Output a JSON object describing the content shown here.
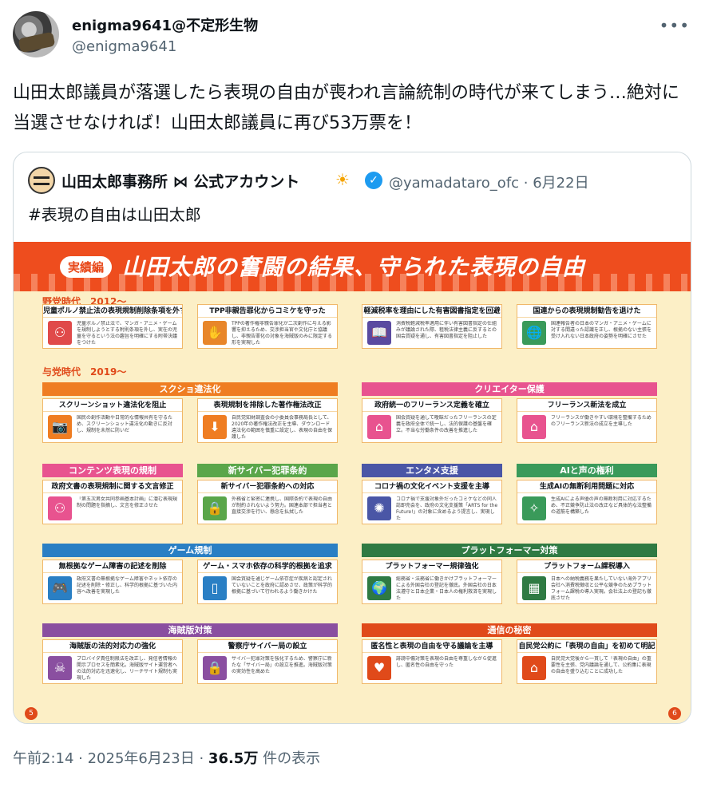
{
  "author": {
    "name": "enigma9641@不定形生物",
    "handle": "@enigma9641"
  },
  "tweet": {
    "text": "山田太郎議員が落選したら表現の自由が喪われ言論統制の時代が来てしまう…絶対に当選させなければ！山田太郎議員に再び53万票を！"
  },
  "quote": {
    "name": "山田太郎事務所 ⋈ 公式アカウント",
    "sun": "☀",
    "verified": "✓",
    "meta": "@yamadataro_ofc · 6月22日",
    "text": "#表現の自由は山田太郎",
    "infographic": {
      "badge": "実績編",
      "title": "山田太郎の奮闘の結果、守られた表現の自由",
      "era_opposition": "野党時代　2012～",
      "era_ruling": "与党時代　2019～",
      "banners": [
        {
          "label": "スクショ違法化",
          "color": "#ef7d22"
        },
        {
          "label": "クリエイター保護",
          "color": "#e8538f"
        },
        {
          "label": "コンテンツ表現の規制",
          "color": "#e8538f"
        },
        {
          "label": "新サイバー犯罪条約",
          "color": "#5aa64a"
        },
        {
          "label": "エンタメ支援",
          "color": "#4a56a6"
        },
        {
          "label": "AIと声の権利",
          "color": "#3a9a5a"
        },
        {
          "label": "ゲーム規制",
          "color": "#2a7fc4"
        },
        {
          "label": "プラットフォーマー対策",
          "color": "#2f7a43"
        },
        {
          "label": "海賊版対策",
          "color": "#8a4fa0"
        },
        {
          "label": "通信の秘密",
          "color": "#e04a1a"
        }
      ],
      "items": [
        {
          "title": "児童ポルノ禁止法の表現規制削除条項を外す",
          "body": "児童ポルノ禁止法で、マンガ・アニメ・ゲームを規制しようとする附則条項を外し、実在の児童を守るという法の趣旨を明確にする附帯決議をつけた",
          "icon": "⚇",
          "color": "#e04a4a"
        },
        {
          "title": "TPP非親告罪化からコミケを守った",
          "body": "TPPの著作権非親告罪化が二次創作に与える影響を抑えるため、交渉担当官や文化庁と協議し、非親告罪化の対象を海賊版のみに限定する形を実現した",
          "icon": "✋",
          "color": "#e8862a"
        },
        {
          "title": "軽減税率を理由にした有害図書指定を回避",
          "body": "消費税軽減税率適用に伴い有害図書指定の仕組みが議論された際、租税法律主義に反するとの国会質疑を通し、有害図書指定を阻止した",
          "icon": "📖",
          "color": "#5a4aa0"
        },
        {
          "title": "国連からの表現規制勧告を退けた",
          "body": "国連報告者の日本のマンガ・アニメ・ゲームに対する間違った認識を正し、根拠のない主張を受け入れない日本政府の姿勢を明確にさせた",
          "icon": "🌐",
          "color": "#3a9a5a"
        },
        {
          "title": "スクリーンショット違法化を阻止",
          "body": "国民の創作活動や日常的な情報共有を守るため、スクリーンショット違法化の動きに反対し、規制を未然に防いだ",
          "icon": "📷",
          "color": "#ef7d22"
        },
        {
          "title": "表現規制を排除した著作権法改正",
          "body": "自民党知財調査会の小委員会事務局長として、2020年の著作権法改正を主導、ダウンロード違法化の範囲を慎重に設定し、表現の自由を保護した",
          "icon": "⬇",
          "color": "#ef7d22"
        },
        {
          "title": "政府統一のフリーランス定義を確立",
          "body": "国会質疑を通して曖昧だったフリーランスの定義を政府全体で統一し、法的保護の基盤を確立。不当な労働条件の改善を推進した",
          "icon": "⌂",
          "color": "#e8538f"
        },
        {
          "title": "フリーランス新法を成立",
          "body": "フリーランスが働きやすい環境を整備するためのフリーランス新法の成立を主導した",
          "icon": "⌂",
          "color": "#e8538f"
        },
        {
          "title": "政府文書の表現規制に関する文言修正",
          "body": "「第五次男女共同参画基本計画」に潜む表現規制の問題を指摘し、文言を修正させた",
          "icon": "⚇",
          "color": "#e8538f"
        },
        {
          "title": "新サイバー犯罪条約への対応",
          "body": "外務省と緊密に連携し、国際条約で表現の自由が制約されないよう努力。国連本部で担当者と直接交渉を行い、懸念を払拭した",
          "icon": "🔒",
          "color": "#5aa64a"
        },
        {
          "title": "コロナ禍の文化イベント支援を主導",
          "body": "コロナ禍で支援対象外だったコミケなどの同人誌即売会を、政府の文化支援策「ARTS for the Future!」の対象に含めるよう提言し、実現した",
          "icon": "✺",
          "color": "#4a56a6"
        },
        {
          "title": "生成AIの無断利用問題に対応",
          "body": "生成AIによる声優の声の無断利用に対応するため、不正競争防止法の改正など具体的な法整備の道筋を構築した",
          "icon": "✧",
          "color": "#3a9a5a"
        },
        {
          "title": "無根拠なゲーム障害の記述を削除",
          "body": "政府文書の無根拠なゲーム障害やネット依存の記述を削除・修正し、科学的根拠に基づいた内容へ改善を実現した",
          "icon": "🎮",
          "color": "#2a7fc4"
        },
        {
          "title": "ゲーム・スマホ依存の科学的根拠を追求",
          "body": "国会質疑を通じゲーム依存症が疾病と認定されていないことを政府に認めさせ、政策が科学的根拠に基づいて行われるよう働きかけた",
          "icon": "▯",
          "color": "#2a7fc4"
        },
        {
          "title": "プラットフォーマー規律強化",
          "body": "総務省・法務省に働きかけプラットフォーマーによる外国会社の登記を徹底。外国会社の日本法遵守と日本企業・日本人の権利救済を実現した",
          "icon": "🌍",
          "color": "#2f7a43"
        },
        {
          "title": "プラットフォーム課税導入",
          "body": "日本への納税義務を果たしていない海外アプリ会社へ消費税徴収と公平な競争のためプラットフォーム課税の導入実現。会社法上の登記も徹底させた",
          "icon": "▦",
          "color": "#2f7a43"
        },
        {
          "title": "海賊版の法的対応力の強化",
          "body": "プロバイダ責任制限法を改正し、発信者情報の開示プロセスを簡素化。海賊版サイト運営者への法的対応を迅速化し、リーチサイト規制も実現した",
          "icon": "☠",
          "color": "#8a4fa0"
        },
        {
          "title": "警察庁サイバー局の設立",
          "body": "サイバー犯罪対策を強化するため、警察庁に新たな「サイバー局」の設立を推進。海賊版対策の実効性を高めた",
          "icon": "🔒",
          "color": "#8a4fa0"
        },
        {
          "title": "匿名性と表現の自由を守る議論を主導",
          "body": "誹謗中傷対策を表現の自由を尊重しながら促進し、匿名性の自由を守った",
          "icon": "♥",
          "color": "#e04a1a"
        },
        {
          "title": "自民党公約に「表現の自由」を初めて明記",
          "body": "自民党大党後から一貫して「表現の自由」の重要性を主張、党内議論を通して、公約集に表現の自由を盛り込むことに成功した",
          "icon": "⌂",
          "color": "#e04a1a"
        }
      ],
      "page_left": "5",
      "page_right": "6"
    }
  },
  "footer": {
    "time": "午前2:14 · 2025年6月23日 · ",
    "views": "36.5万",
    "views_label": " 件の表示"
  }
}
